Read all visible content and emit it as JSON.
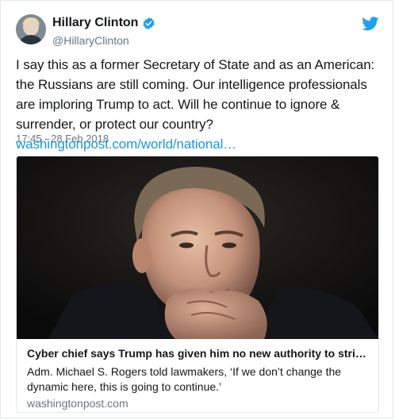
{
  "author": {
    "name": "Hillary Clinton",
    "handle": "@HillaryClinton",
    "verified_icon": "verified-badge-icon",
    "avatar_icon": "avatar"
  },
  "brand": {
    "icon": "twitter-bird-icon",
    "accent": "#1da1f2"
  },
  "tweet": {
    "text": "I say this as a former Secretary of State and as an American: the Russians are still coming. Our intelligence professionals are imploring Trump to act. Will he continue to ignore & surrender, or protect our country?",
    "link": "washingtonpost.com/world/national…",
    "timestamp": "17:45 - 28 Feb 2018"
  },
  "card": {
    "title": "Cyber chief says Trump has given him no new authority to stri…",
    "description": "Adm. Michael S. Rogers told lawmakers, ‘If we don’t change the dynamic here, this is going to continue.’",
    "domain": "washingtonpost.com"
  },
  "colors": {
    "text": "#14171a",
    "muted": "#657786",
    "link": "#1b95e0",
    "border": "#e1e8ed"
  }
}
